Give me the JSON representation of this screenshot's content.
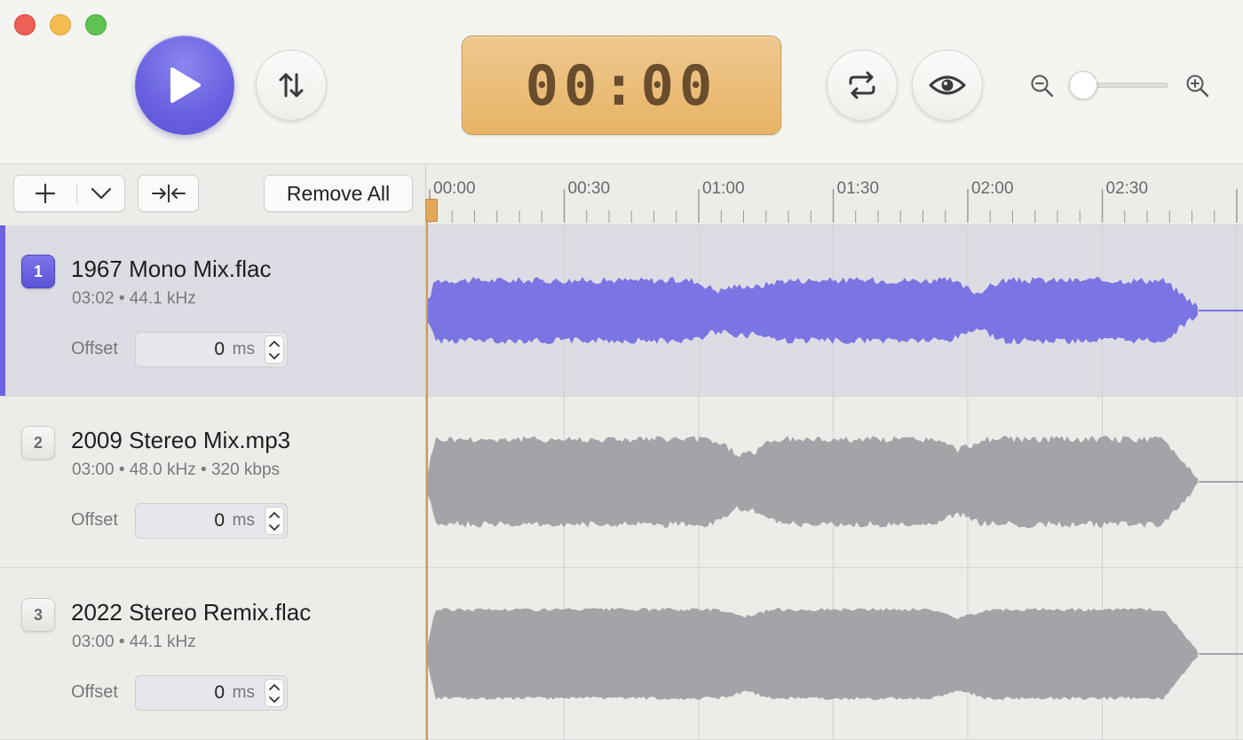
{
  "window": {
    "controls": [
      "close",
      "minimize",
      "zoom"
    ]
  },
  "toolbar": {
    "play_icon": "play-icon",
    "sync_icon": "arrow-swap-icon",
    "timer": "00:00",
    "repeat_icon": "repeat-icon",
    "eye_icon": "eye-icon",
    "zoom_out_icon": "zoom-out-icon",
    "zoom_in_icon": "zoom-in-icon",
    "zoom_level": 0.0,
    "accent_color": "#6a62e0",
    "lcd_color": "#e9b96f"
  },
  "list_controls": {
    "add_icon": "plus-icon",
    "menu_icon": "chevron-down-icon",
    "align_icon": "align-center-icon",
    "remove_all_label": "Remove All"
  },
  "ruler": {
    "labels": [
      "00:00",
      "00:30",
      "01:00",
      "01:30",
      "02:00",
      "02:30"
    ]
  },
  "tracks": [
    {
      "number": "1",
      "name": "1967 Mono Mix.flac",
      "meta": "03:02 • 44.1 kHz",
      "offset_label": "Offset",
      "offset_value": "0",
      "offset_unit": "ms",
      "selected": true,
      "waveform_color": "#7b74e3"
    },
    {
      "number": "2",
      "name": "2009 Stereo Mix.mp3",
      "meta": "03:00 • 48.0 kHz • 320 kbps",
      "offset_label": "Offset",
      "offset_value": "0",
      "offset_unit": "ms",
      "selected": false,
      "waveform_color": "#a4a4a8"
    },
    {
      "number": "3",
      "name": "2022 Stereo Remix.flac",
      "meta": "03:00 • 44.1 kHz",
      "offset_label": "Offset",
      "offset_value": "0",
      "offset_unit": "ms",
      "selected": false,
      "waveform_color": "#a4a4a8"
    }
  ]
}
